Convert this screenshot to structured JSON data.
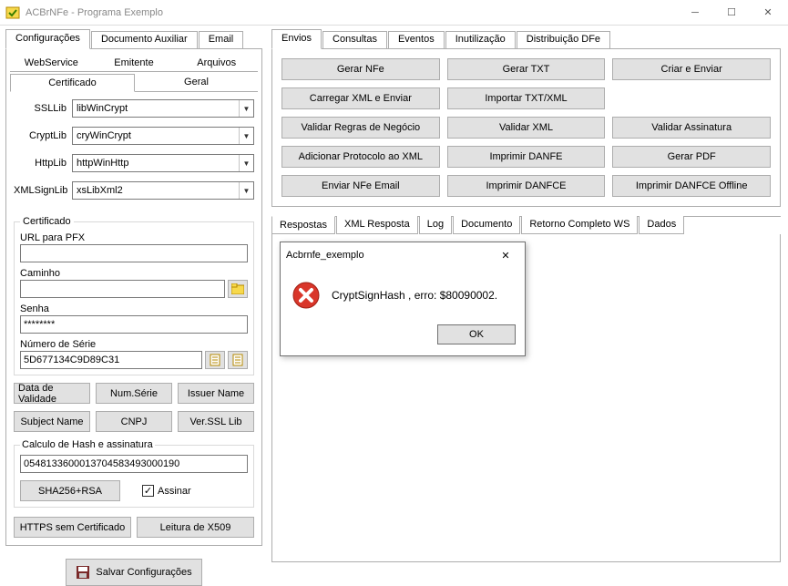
{
  "window": {
    "title": "ACBrNFe - Programa Exemplo"
  },
  "leftTabs": {
    "configuracoes": "Configurações",
    "docAux": "Documento Auxiliar",
    "email": "Email"
  },
  "innerTabs": {
    "webservice": "WebService",
    "emitente": "Emitente",
    "arquivos": "Arquivos",
    "certificado": "Certificado",
    "geral": "Geral"
  },
  "libs": {
    "ssl_lbl": "SSLLib",
    "ssl_val": "libWinCrypt",
    "crypt_lbl": "CryptLib",
    "crypt_val": "cryWinCrypt",
    "http_lbl": "HttpLib",
    "http_val": "httpWinHttp",
    "xml_lbl": "XMLSignLib",
    "xml_val": "xsLibXml2"
  },
  "cert": {
    "legend": "Certificado",
    "url_lbl": "URL para PFX",
    "url_val": "",
    "caminho_lbl": "Caminho",
    "caminho_val": "",
    "senha_lbl": "Senha",
    "senha_val": "********",
    "serie_lbl": "Número de Série",
    "serie_val": "5D677134C9D89C31",
    "btn_data": "Data de Validade",
    "btn_numserie": "Num.Série",
    "btn_issuer": "Issuer Name",
    "btn_subject": "Subject Name",
    "btn_cnpj": "CNPJ",
    "btn_ver": "Ver.SSL Lib"
  },
  "hash": {
    "legend": "Calculo de Hash e assinatura",
    "value": "0548133600013704583493000190",
    "btn_sha": "SHA256+RSA",
    "cb_assinar": "Assinar",
    "cb_checked": "✓"
  },
  "extra": {
    "btn_https": "HTTPS sem Certificado",
    "btn_leitura": "Leitura de X509",
    "btn_salvar": "Salvar Configurações"
  },
  "rightTabs": {
    "envios": "Envios",
    "consultas": "Consultas",
    "eventos": "Eventos",
    "inutil": "Inutilização",
    "dist": "Distribuição DFe"
  },
  "actions": {
    "gerarNfe": "Gerar NFe",
    "gerarTxt": "Gerar TXT",
    "criarEnviar": "Criar e Enviar",
    "carregarXml": "Carregar XML e Enviar",
    "importarTxt": "Importar TXT/XML",
    "validarRegras": "Validar Regras de Negócio",
    "validarXml": "Validar XML",
    "validarAss": "Validar Assinatura",
    "addProto": "Adicionar Protocolo ao XML",
    "impDanfe": "Imprimir DANFE",
    "gerarPdf": "Gerar PDF",
    "envEmail": "Enviar NFe Email",
    "impDanfce": "Imprimir DANFCE",
    "impDanfceOff": "Imprimir DANFCE Offline"
  },
  "lowerTabs": {
    "respostas": "Respostas",
    "xmlResp": "XML Resposta",
    "log": "Log",
    "documento": "Documento",
    "retorno": "Retorno Completo WS",
    "dados": "Dados"
  },
  "dialog": {
    "title": "Acbrnfe_exemplo",
    "msg": "CryptSignHash , erro: $80090002.",
    "ok": "OK"
  }
}
